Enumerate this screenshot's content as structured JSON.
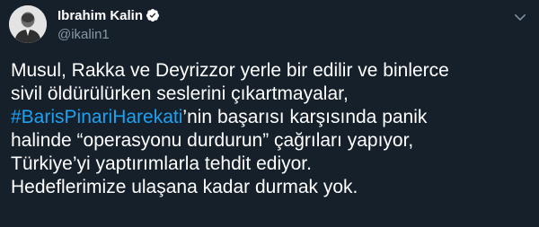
{
  "user": {
    "display_name": "Ibrahim Kalin",
    "handle": "@ikalin1",
    "verified": true,
    "avatar_icon": "portrait-avatar"
  },
  "tweet": {
    "line1": "Musul, Rakka ve Deyrizzor yerle bir edilir ve binlerce",
    "line2": "sivil öldürülürken seslerini çıkartmayalar,",
    "hashtag": "#BarisPinariHarekati",
    "line3_rest": "’nin başarısı karşısında panik",
    "line4": "halinde “operasyonu durdurun” çağrıları yapıyor,",
    "line5": "Türkiye’yi yaptırımlarla tehdit ediyor.",
    "line6": "Hedeflerimize ulaşana kadar durmak yok."
  },
  "colors": {
    "background": "#15202b",
    "text": "#ffffff",
    "secondary_text": "#8899a6",
    "link": "#1da1f2"
  },
  "icons": {
    "verified": "verified-badge-icon",
    "menu": "chevron-down-icon"
  }
}
